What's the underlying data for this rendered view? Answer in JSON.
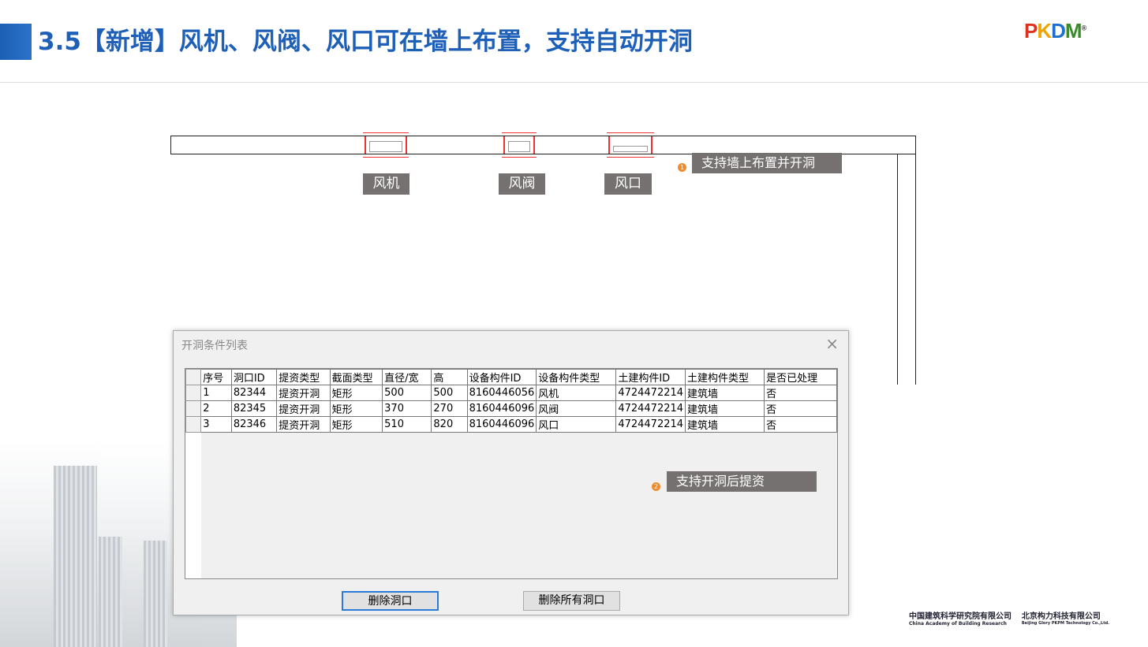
{
  "header": {
    "title": "3.5【新增】风机、风阀、风口可在墙上布置，支持自动开洞",
    "logo": "PKPM"
  },
  "drawing": {
    "labels": [
      "风机",
      "风阀",
      "风口"
    ],
    "note1": {
      "num": "1",
      "text": "支持墙上布置并开洞"
    },
    "note2": {
      "num": "2",
      "text": "支持开洞后提资"
    }
  },
  "dialog": {
    "title": "开洞条件列表",
    "close": "×",
    "columns": [
      "序号",
      "洞口ID",
      "提资类型",
      "截面类型",
      "直径/宽",
      "高",
      "设备构件ID",
      "设备构件类型",
      "土建构件ID",
      "土建构件类型",
      "是否已处理"
    ],
    "rows": [
      [
        "1",
        "82344",
        "提资开洞",
        "矩形",
        "500",
        "500",
        "8160446056",
        "风机",
        "4724472214",
        "建筑墙",
        "否"
      ],
      [
        "2",
        "82345",
        "提资开洞",
        "矩形",
        "370",
        "270",
        "8160446096",
        "风阀",
        "4724472214",
        "建筑墙",
        "否"
      ],
      [
        "3",
        "82346",
        "提资开洞",
        "矩形",
        "510",
        "820",
        "8160446096",
        "风口",
        "4724472214",
        "建筑墙",
        "否"
      ]
    ],
    "delete_button": "删除洞口",
    "delete_all_button": "删除所有洞口"
  },
  "footer": {
    "org1": "中国建筑科学研究院有限公司",
    "org1_en": "China Academy of Building Research",
    "org2": "北京构力科技有限公司",
    "org2_en": "Beijing Glory PKPM Technology Co.,Ltd."
  }
}
